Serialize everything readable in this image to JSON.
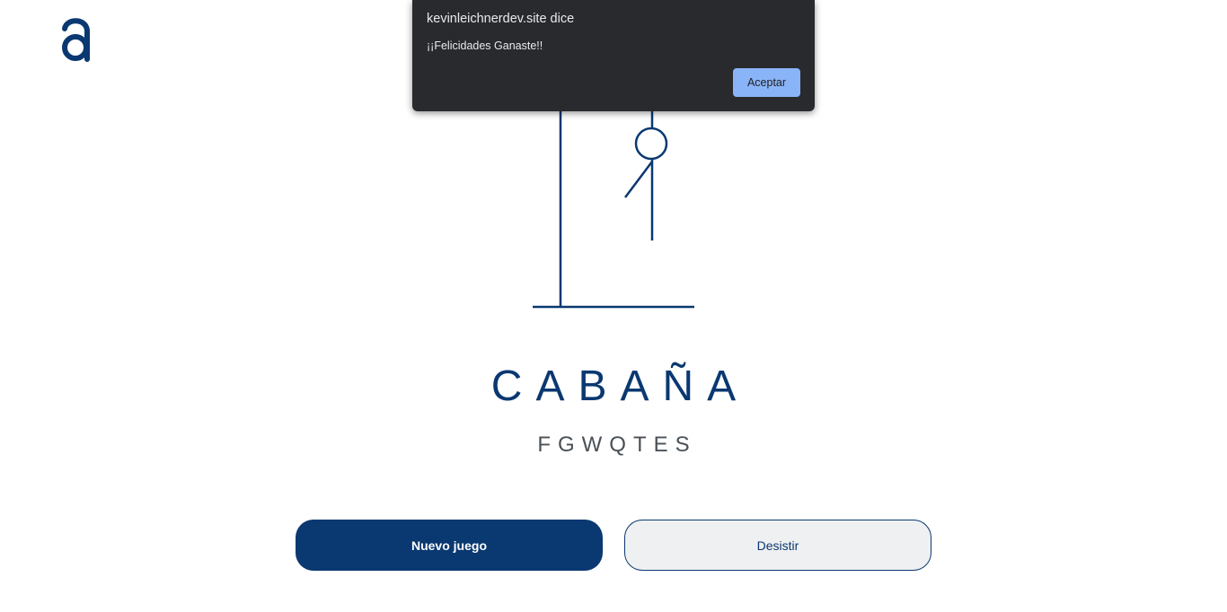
{
  "colors": {
    "accent": "#0a3871",
    "dialog_bg": "#292a2d",
    "dialog_button": "#8ab4f8",
    "secondary_button_bg": "#eff0f1",
    "wrong_letters": "#495057"
  },
  "header": {
    "logo_icon": "alura-a-logo-icon"
  },
  "dialog": {
    "title": "kevinleichnerdev.site dice",
    "message": "¡¡Felicidades Ganaste!!",
    "ok_label": "Aceptar"
  },
  "game": {
    "word": "CABAÑA",
    "wrong_letters": "FGWQTES"
  },
  "actions": {
    "new_game_label": "Nuevo juego",
    "quit_label": "Desistir"
  }
}
